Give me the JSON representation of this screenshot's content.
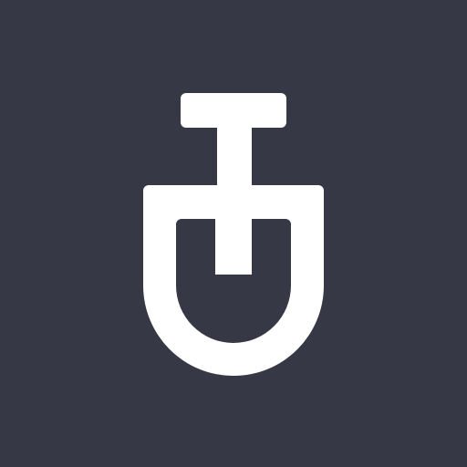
{
  "colors": {
    "background": "#373846",
    "mark": "#FFFFFF"
  },
  "icon": {
    "name": "shovel-icon"
  }
}
